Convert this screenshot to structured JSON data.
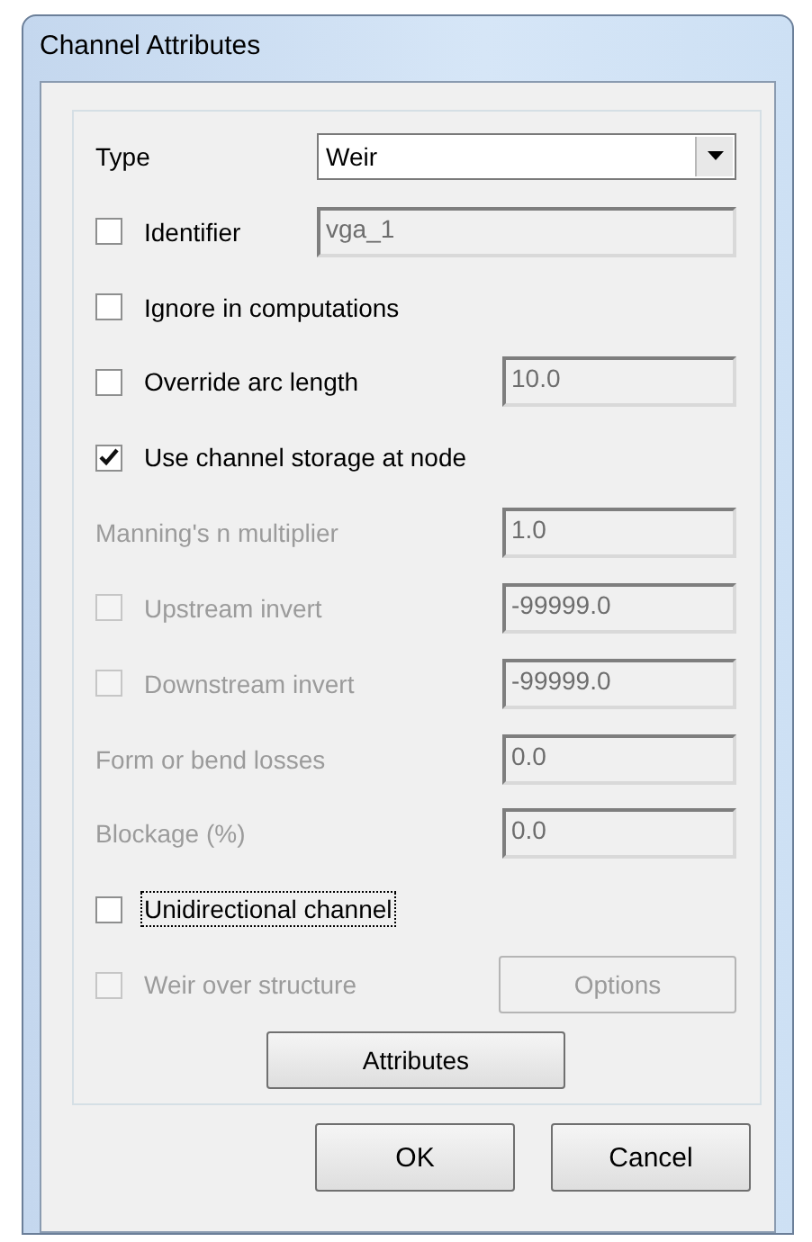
{
  "window": {
    "title": "Channel Attributes"
  },
  "rows": [
    {
      "kind": "select",
      "label": "Type",
      "value": "Weir"
    },
    {
      "kind": "check-field",
      "label": "Identifier",
      "checked": false,
      "disabled": false,
      "value": "vga_1",
      "field_disabled": true,
      "wide": true
    },
    {
      "kind": "check",
      "label": "Ignore in computations",
      "checked": false,
      "disabled": false
    },
    {
      "kind": "check-field",
      "label": "Override arc length",
      "checked": false,
      "disabled": false,
      "value": "10.0",
      "field_disabled": true,
      "wide": false
    },
    {
      "kind": "check",
      "label": "Use channel storage at node",
      "checked": true,
      "disabled": false
    },
    {
      "kind": "label-field",
      "label": "Manning's n multiplier",
      "disabled": true,
      "value": "1.0",
      "field_disabled": true
    },
    {
      "kind": "check-field",
      "label": "Upstream invert",
      "checked": false,
      "disabled": true,
      "value": "-99999.0",
      "field_disabled": true,
      "wide": false
    },
    {
      "kind": "check-field",
      "label": "Downstream invert",
      "checked": false,
      "disabled": true,
      "value": "-99999.0",
      "field_disabled": true,
      "wide": false
    },
    {
      "kind": "label-field",
      "label": "Form or bend losses",
      "disabled": true,
      "value": "0.0",
      "field_disabled": true
    },
    {
      "kind": "label-field",
      "label": "Blockage (%)",
      "disabled": true,
      "value": "0.0",
      "field_disabled": true
    },
    {
      "kind": "check",
      "label": "Unidirectional channel",
      "checked": false,
      "disabled": false,
      "focused": true
    },
    {
      "kind": "check-button",
      "label": "Weir over structure",
      "checked": false,
      "disabled": true,
      "button": "Options",
      "button_disabled": true
    }
  ],
  "center_button": "Attributes",
  "buttons": [
    "OK",
    "Cancel"
  ]
}
